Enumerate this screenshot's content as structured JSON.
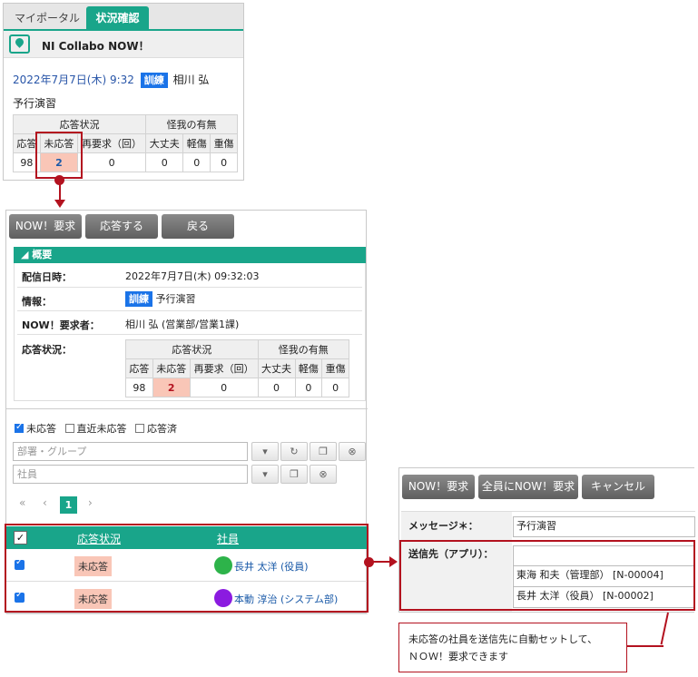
{
  "portlet": {
    "tabs": [
      "マイポータル",
      "状況確認"
    ],
    "app_title": "NI Collabo NOW！",
    "datetime": "2022年7月7日(木) 9:32",
    "badge": "訓練",
    "person": "相川 弘",
    "info": "予行演習"
  },
  "status_table": {
    "group_response": "応答状況",
    "group_injury": "怪我の有無",
    "cols": [
      "応答",
      "未応答",
      "再要求（回）",
      "大丈夫",
      "軽傷",
      "重傷"
    ],
    "values": [
      "98",
      "2",
      "0",
      "0",
      "0",
      "0"
    ]
  },
  "detail": {
    "buttons": [
      "NOW！要求",
      "応答する",
      "戻る"
    ],
    "section_title": "概要",
    "fields": {
      "sent_label": "配信日時：",
      "sent_value": "2022年7月7日(木) 09:32:03",
      "info_label": "情報：",
      "info_badge": "訓練",
      "info_value": "予行演習",
      "requester_label": "NOW！要求者：",
      "requester_value": "相川 弘 (営業部/営業1課)",
      "status_label": "応答状況："
    },
    "filters": [
      "未応答",
      "直近未応答",
      "応答済"
    ],
    "dept_placeholder": "部署・グループ",
    "emp_placeholder": "社員",
    "pagination": {
      "first": "«",
      "prev": "‹",
      "current": "1",
      "next": "›"
    },
    "list": {
      "header_check": "✓",
      "col_status": "応答状況",
      "col_employee": "社員",
      "rows": [
        {
          "status": "未応答",
          "name": "長井 太洋 (役員)",
          "avatar_color": "#2db34a"
        },
        {
          "status": "未応答",
          "name": "本動 淳治 (システム部)",
          "avatar_color": "#8b1be0"
        }
      ]
    }
  },
  "form": {
    "buttons": [
      "NOW！要求",
      "全員にNOW！要求",
      "キャンセル"
    ],
    "message_label": "メッセージ＊：",
    "message_value": "予行演習",
    "dest_label": "送信先（アプリ）：",
    "dest_entries": [
      "東海 和夫（管理部） [N-00004]",
      "長井 太洋（役員） [N-00002]"
    ]
  },
  "note": {
    "line1": "未応答の社員を送信先に自動セットして、",
    "line2": "ＮＯＷ！要求できます"
  },
  "colors": {
    "accent": "#19a58a",
    "highlight": "#b3121f",
    "badge": "#1a73e8"
  }
}
